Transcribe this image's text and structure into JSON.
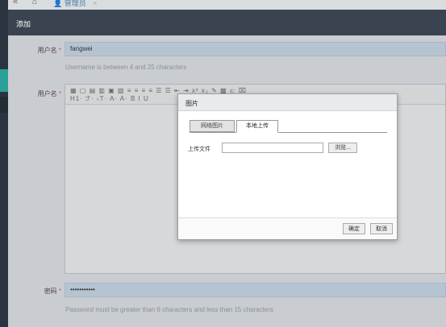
{
  "topbar": {
    "collapse_icon": "«",
    "home_icon": "⌂",
    "tab_icon": "👤",
    "tab_label": "管理员",
    "tab_close": "×"
  },
  "header": {
    "title": "添加"
  },
  "form": {
    "username": {
      "label": "用户名",
      "required": "*",
      "value": "fangwei",
      "help": "Username is between 4 and 25 characters"
    },
    "content": {
      "label": "用户名",
      "required": "*"
    },
    "password": {
      "label": "密码",
      "required": "*",
      "value": "•••••••••••",
      "help": "Password must be greater than 6 characters and less than 15 characters"
    }
  },
  "editor": {
    "toolbar_row1": "▦ ▢ ▤ ▥ ▣ ▧ ≡ ≡ ≡ ≡ ☰ ☰ ⇤ ⇥ x² x₂ ✎ ▩ ⊏ ⌧",
    "toolbar_row2": "H1· ℱ· ₜT· A· A· B I U"
  },
  "dialog": {
    "title": "图片",
    "tabs": [
      "网络图片",
      "本地上传"
    ],
    "upload_label": "上传文件",
    "browse_label": "浏览...",
    "ok_label": "确定",
    "cancel_label": "取消"
  }
}
